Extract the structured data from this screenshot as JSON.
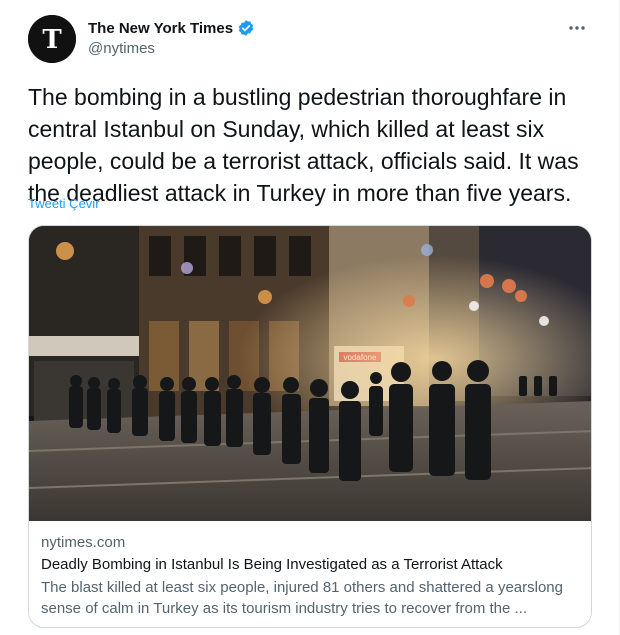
{
  "author": {
    "name": "The New York Times",
    "handle": "@nytimes",
    "verified": true,
    "verified_color": "#1d9bf0"
  },
  "more_icon": "ellipsis-icon",
  "tweet": {
    "text": "The bombing in a bustling pedestrian thoroughfare in central Istanbul on Sunday, which killed at least six people, could be a terrorist attack, officials said. It was the deadliest attack in Turkey in more than five years.",
    "translate_label": "Tweeti Çevir"
  },
  "card": {
    "domain": "nytimes.com",
    "title": "Deadly Bombing in Istanbul Is Being Investigated as a Terrorist Attack",
    "description": "The blast killed at least six people, injured 81 others and shattered a yearslong sense of calm in Turkey as its tourism industry tries to recover from the ...",
    "shop_sign": "vodafone"
  },
  "colors": {
    "link": "#1d9bf0",
    "secondary_text": "#536471",
    "primary_text": "#0f1419",
    "border": "#cfd9de"
  }
}
